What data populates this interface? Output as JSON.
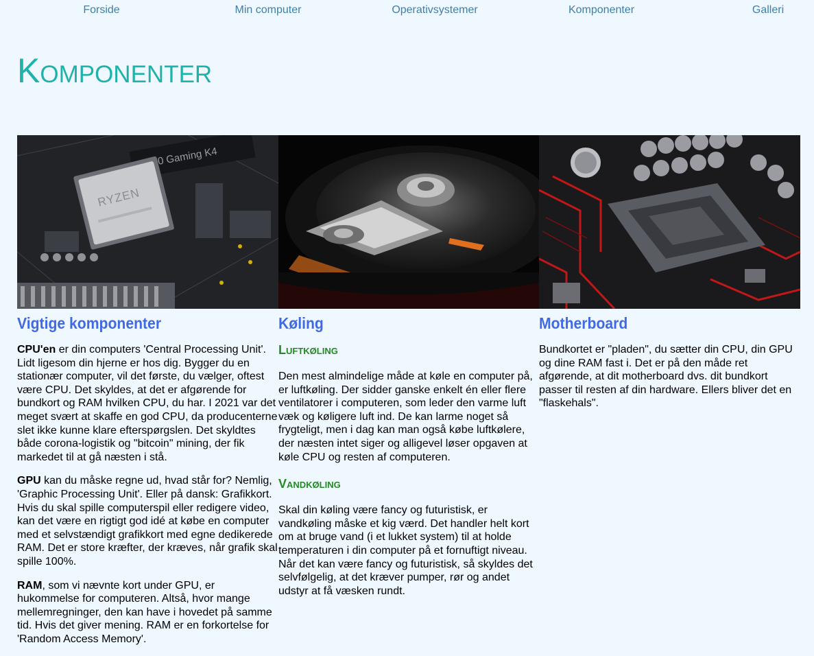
{
  "nav": {
    "items": [
      {
        "label": "Forside"
      },
      {
        "label": "Min computer"
      },
      {
        "label": "Operativsystemer"
      },
      {
        "label": "Komponenter"
      },
      {
        "label": "Galleri"
      }
    ]
  },
  "page_title": "Komponenter",
  "columns": [
    {
      "image": "cpu-motherboard-photo",
      "image_text": "B450 Gaming K4",
      "chip_text": "RYZEN",
      "title": "Vigtige komponenter",
      "paragraphs": [
        {
          "strong": "CPU'en",
          "text": " er din computers 'Central Processing Unit'. Lidt ligesom din hjerne er hos dig. Bygger du en stationær computer, vil det første, du vælger, oftest være CPU. Det skyldes, at det er afgørende for bundkort og RAM hvilken CPU, du har. I 2021 var det meget svært at skaffe en god CPU, da producenterne slet ikke kunne klare efterspørgslen. Det skyldtes både corona-logistik og \"bitcoin\" mining, der fik markedet til at gå næsten i stå."
        },
        {
          "strong": "GPU",
          "text": " kan du måske regne ud, hvad står for? Nemlig, 'Graphic Processing Unit'. Eller på dansk: Grafikkort. Hvis du skal spille computerspil eller redigere video, kan det være en rigtigt god idé at købe en computer med et selvstændigt grafikkort med egne dedikerede RAM. Det er store kræfter, der kræves, når grafik skal spille 100%."
        },
        {
          "strong": "RAM",
          "text": ", som vi nævnte kort under GPU, er hukommelse for computeren. Altså, hvor mange mellemregninger, den kan have i hovedet på samme tid. Hvis det giver mening. RAM er en forkortelse for 'Random Access Memory'."
        }
      ]
    },
    {
      "image": "hard-drive-photo",
      "title": "Køling",
      "sections": [
        {
          "heading": "Luftkøling",
          "text": "Den mest almindelige måde at køle en computer på, er luftkøling. Der sidder ganske enkelt én eller flere ventilatorer i computeren, som leder den varme luft væk og køligere luft ind. De kan larme noget så frygteligt, men i dag kan man også købe luftkølere, der næsten intet siger og alligevel løser opgaven at køle CPU og resten af computeren."
        },
        {
          "heading": "Vandkøling",
          "text": "Skal din køling være fancy og futuristisk, er vandkøling måske et kig værd. Det handler helt kort om at bruge vand (i et lukket system) til at holde temperaturen i din computer på et fornuftigt niveau. Når det kan være fancy og futuristisk, så skyldes det selvfølgelig, at det kræver pumper, rør og andet udstyr at få væsken rundt."
        }
      ]
    },
    {
      "image": "motherboard-socket-photo",
      "title": "Motherboard",
      "text": "Bundkortet er \"pladen\", du sætter din CPU, din GPU og dine RAM fast i. Det er på den måde ret afgørende, at dit motherboard dvs. dit bundkort passer til resten af din hardware. Ellers bliver det en \"flaskehals\"."
    }
  ]
}
